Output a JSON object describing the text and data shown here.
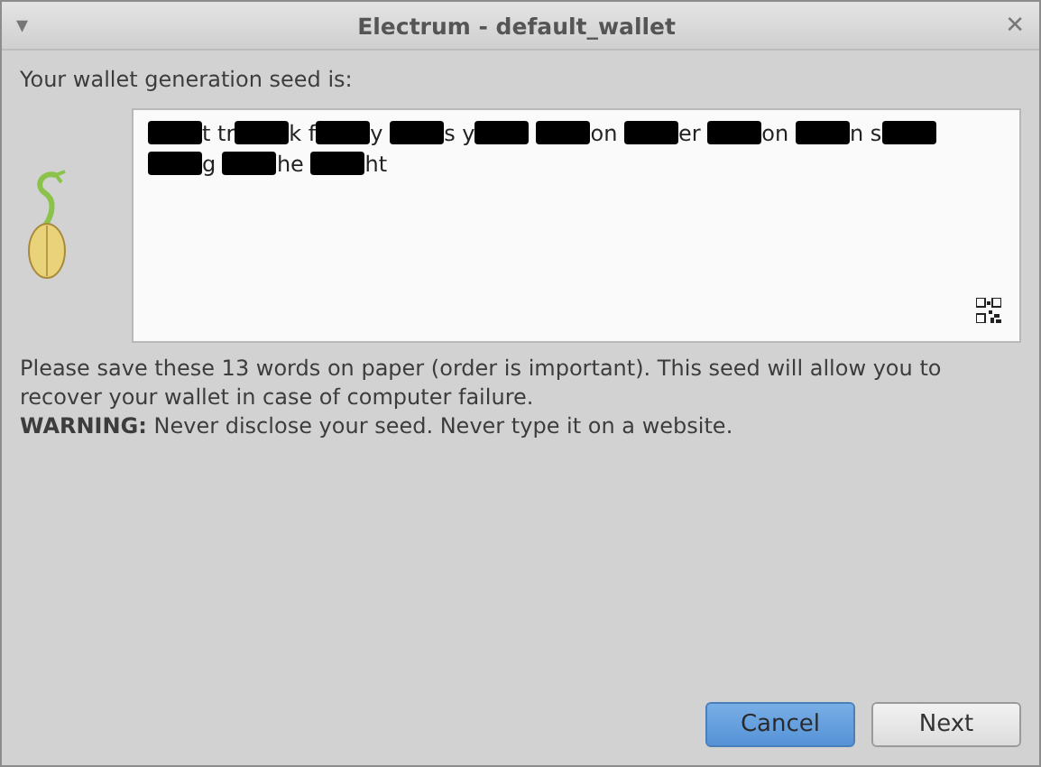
{
  "window": {
    "title": "Electrum  -  default_wallet",
    "menu_glyph": "▾",
    "close_glyph": "✕"
  },
  "heading": "Your wallet generation seed is:",
  "seed": [
    {
      "kind": "redaction"
    },
    {
      "kind": "text",
      "text": "t tr"
    },
    {
      "kind": "redaction"
    },
    {
      "kind": "text",
      "text": "k f"
    },
    {
      "kind": "redaction"
    },
    {
      "kind": "text",
      "text": "y "
    },
    {
      "kind": "redaction"
    },
    {
      "kind": "text",
      "text": "s y"
    },
    {
      "kind": "redaction"
    },
    {
      "kind": "gap"
    },
    {
      "kind": "redaction"
    },
    {
      "kind": "text",
      "text": "on "
    },
    {
      "kind": "redaction"
    },
    {
      "kind": "text",
      "text": "er "
    },
    {
      "kind": "redaction"
    },
    {
      "kind": "text",
      "text": "on "
    },
    {
      "kind": "redaction"
    },
    {
      "kind": "text",
      "text": "n s"
    },
    {
      "kind": "redaction"
    },
    {
      "kind": "gap"
    },
    {
      "kind": "redaction"
    },
    {
      "kind": "text",
      "text": "g "
    },
    {
      "kind": "redaction"
    },
    {
      "kind": "text",
      "text": "he "
    },
    {
      "kind": "redaction"
    },
    {
      "kind": "text",
      "text": "ht"
    }
  ],
  "info": "Please save these 13 words on paper (order is important). This seed will allow you to recover your wallet in case of computer failure.",
  "warning": "**WARNING:** Never disclose your seed. Never type it on a website.",
  "buttons": [
    {
      "label": "Cancel",
      "selected": true
    },
    {
      "label": "Next",
      "selected": false
    }
  ]
}
